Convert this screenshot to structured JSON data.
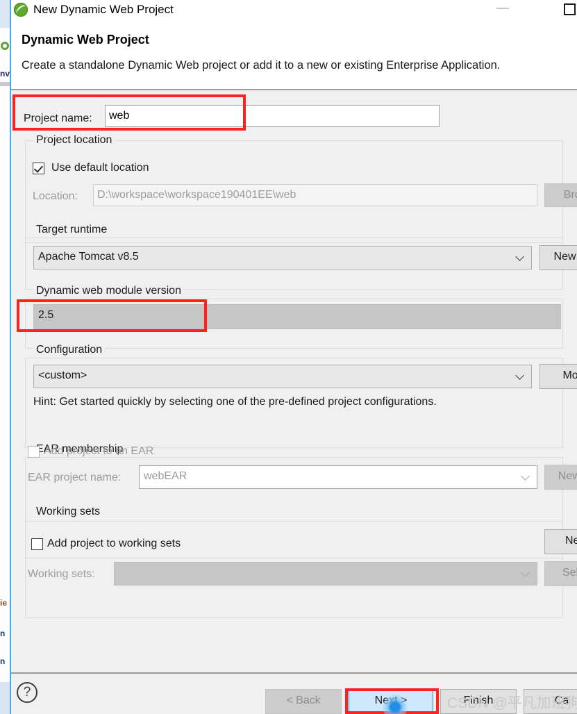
{
  "window": {
    "title": "New Dynamic Web Project",
    "app_icon": "eclipse-green-circle-icon",
    "minimize_label": "–",
    "maximize_label": "□"
  },
  "header": {
    "title": "Dynamic Web Project",
    "description": "Create a standalone Dynamic Web project or add it to a new or existing Enterprise Application."
  },
  "form": {
    "project_name": {
      "label": "Project name:",
      "value": "web",
      "placeholder": ""
    },
    "project_location": {
      "group_title": "Project location",
      "use_default_label": "Use default location",
      "use_default_checked": true,
      "location_label": "Location:",
      "location_value": "D:\\workspace\\workspace190401EE\\web",
      "browse_button": "Brow"
    },
    "target_runtime": {
      "group_title": "Target runtime",
      "value": "Apache Tomcat v8.5",
      "new_runtime_button": "New Ru"
    },
    "module_version": {
      "group_title": "Dynamic web module version",
      "value": "2.5"
    },
    "configuration": {
      "group_title": "Configuration",
      "value": "<custom>",
      "modify_button": "Mod",
      "hint": "Hint: Get started quickly by selecting one of the pre-defined project configurations."
    },
    "ear_membership": {
      "group_title": "EAR membership",
      "add_to_ear_label": "Add project to an EAR",
      "add_to_ear_checked": false,
      "ear_project_label": "EAR project name:",
      "ear_project_value": "webEAR",
      "new_project_button": "New Pr"
    },
    "working_sets": {
      "group_title": "Working sets",
      "add_to_working_sets_label": "Add project to working sets",
      "add_to_working_sets_checked": false,
      "working_sets_label": "Working sets:",
      "working_sets_value": "",
      "new_button": "New",
      "select_button": "Selec"
    }
  },
  "footer": {
    "help_glyph": "?",
    "back_button": "< Back",
    "next_button": "Next >",
    "finish_button": "Finish",
    "cancel_button": "Ca"
  },
  "annotations": {
    "watermark": "CSDN @平凡加班狗",
    "highlight_color": "#fb2222",
    "cursor_color": "#1f8fe8"
  },
  "background_app": {
    "fragments": [
      "nv",
      "ie",
      "n",
      "n"
    ]
  }
}
